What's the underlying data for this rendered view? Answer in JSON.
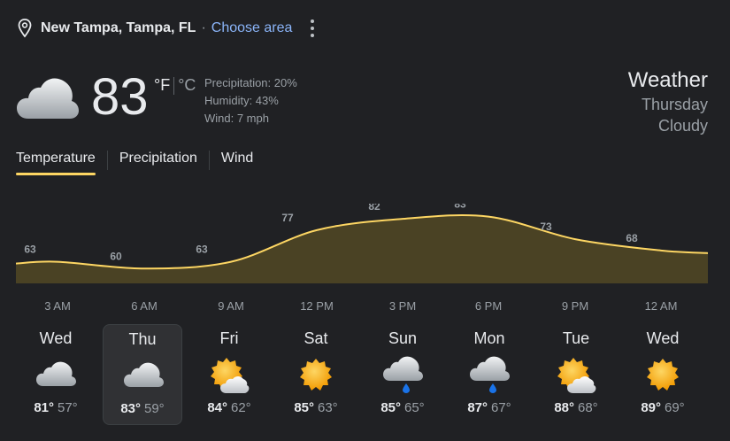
{
  "location": {
    "name": "New Tampa, Tampa, FL",
    "separator": "·",
    "choose_area": "Choose area"
  },
  "current": {
    "icon": "cloudy-icon",
    "temperature": "83",
    "unit_f": "°F",
    "unit_c": "°C",
    "precipitation": "Precipitation: 20%",
    "humidity": "Humidity: 43%",
    "wind": "Wind: 7 mph"
  },
  "side": {
    "title": "Weather",
    "day": "Thursday",
    "condition": "Cloudy"
  },
  "tabs": [
    {
      "label": "Temperature",
      "active": true
    },
    {
      "label": "Precipitation",
      "active": false
    },
    {
      "label": "Wind",
      "active": false
    }
  ],
  "chart_data": {
    "type": "area",
    "x": [
      "3 AM",
      "6 AM",
      "9 AM",
      "12 PM",
      "3 PM",
      "6 PM",
      "9 PM",
      "12 AM"
    ],
    "values": [
      63,
      60,
      63,
      77,
      82,
      83,
      73,
      68
    ],
    "color": "#fdd663",
    "fill": "#4a4224"
  },
  "hours": [
    "3 AM",
    "6 AM",
    "9 AM",
    "12 PM",
    "3 PM",
    "6 PM",
    "9 PM",
    "12 AM"
  ],
  "forecast": [
    {
      "day": "Wed",
      "icon": "cloudy-icon",
      "high": "81°",
      "low": "57°",
      "selected": false
    },
    {
      "day": "Thu",
      "icon": "cloudy-icon",
      "high": "83°",
      "low": "59°",
      "selected": true
    },
    {
      "day": "Fri",
      "icon": "partly-sunny-icon",
      "high": "84°",
      "low": "62°",
      "selected": false
    },
    {
      "day": "Sat",
      "icon": "sunny-icon",
      "high": "85°",
      "low": "63°",
      "selected": false
    },
    {
      "day": "Sun",
      "icon": "showers-icon",
      "high": "85°",
      "low": "65°",
      "selected": false
    },
    {
      "day": "Mon",
      "icon": "showers-icon",
      "high": "87°",
      "low": "67°",
      "selected": false
    },
    {
      "day": "Tue",
      "icon": "partly-sunny-icon",
      "high": "88°",
      "low": "68°",
      "selected": false
    },
    {
      "day": "Wed",
      "icon": "sunny-icon",
      "high": "89°",
      "low": "69°",
      "selected": false
    }
  ]
}
